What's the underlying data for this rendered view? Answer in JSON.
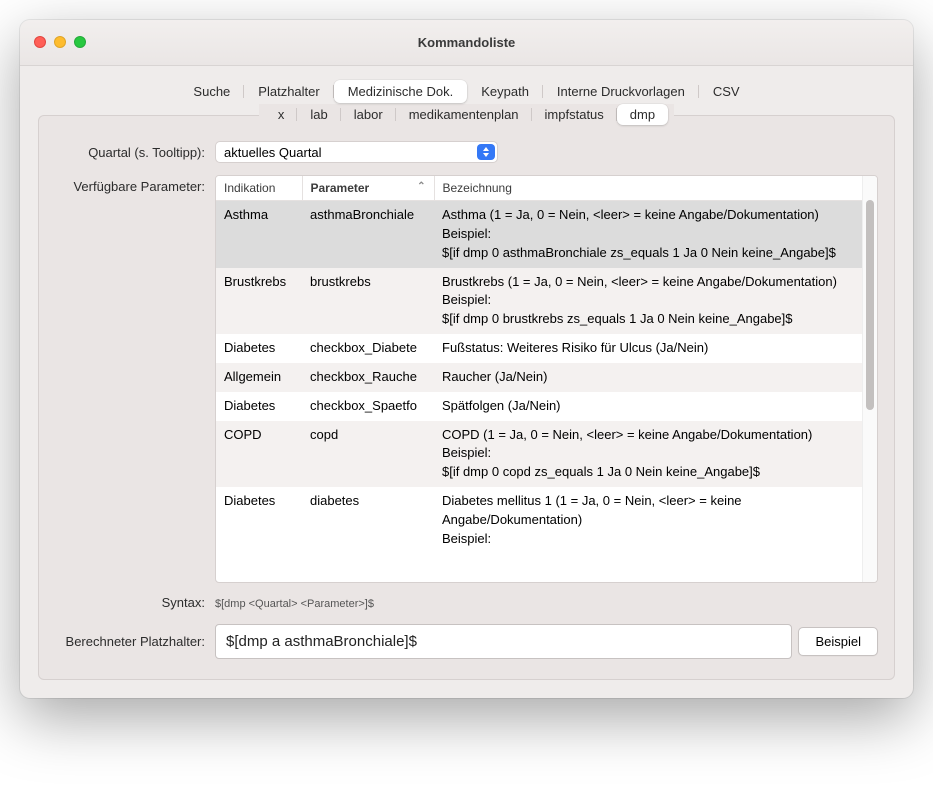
{
  "window": {
    "title": "Kommandoliste"
  },
  "mainTabs": [
    {
      "label": "Suche",
      "active": false
    },
    {
      "label": "Platzhalter",
      "active": false
    },
    {
      "label": "Medizinische Dok.",
      "active": true
    },
    {
      "label": "Keypath",
      "active": false
    },
    {
      "label": "Interne Druckvorlagen",
      "active": false
    },
    {
      "label": "CSV",
      "active": false
    }
  ],
  "subTabs": [
    {
      "label": "x",
      "active": false
    },
    {
      "label": "lab",
      "active": false
    },
    {
      "label": "labor",
      "active": false
    },
    {
      "label": "medikamentenplan",
      "active": false
    },
    {
      "label": "impfstatus",
      "active": false
    },
    {
      "label": "dmp",
      "active": true
    }
  ],
  "labels": {
    "quartal": "Quartal (s. Tooltipp):",
    "parameter": "Verfügbare Parameter:",
    "syntax": "Syntax:",
    "platzhalter": "Berechneter Platzhalter:"
  },
  "quartal": {
    "value": "aktuelles Quartal"
  },
  "columns": {
    "indikation": "Indikation",
    "parameter": "Parameter",
    "bezeichnung": "Bezeichnung"
  },
  "rows": [
    {
      "ind": "Asthma",
      "par": "asthmaBronchiale",
      "bez": "Asthma (1 = Ja, 0 = Nein, <leer> = keine Angabe/Dokumentation)\nBeispiel:\n$[if dmp 0 asthmaBronchiale zs_equals 1 Ja 0 Nein keine_Angabe]$",
      "selected": true
    },
    {
      "ind": "Brustkrebs",
      "par": "brustkrebs",
      "bez": "Brustkrebs (1 = Ja, 0 = Nein, <leer> = keine Angabe/Dokumentation)\nBeispiel:\n$[if dmp 0 brustkrebs zs_equals 1 Ja 0 Nein keine_Angabe]$"
    },
    {
      "ind": "Diabetes",
      "par": "checkbox_Diabete",
      "bez": "Fußstatus: Weiteres Risiko für Ulcus (Ja/Nein)"
    },
    {
      "ind": "Allgemein",
      "par": "checkbox_Rauche",
      "bez": "Raucher (Ja/Nein)"
    },
    {
      "ind": "Diabetes",
      "par": "checkbox_Spaetfo",
      "bez": "Spätfolgen (Ja/Nein)"
    },
    {
      "ind": "COPD",
      "par": "copd",
      "bez": "COPD (1 = Ja, 0 = Nein, <leer> = keine Angabe/Dokumentation)\nBeispiel:\n$[if dmp 0 copd zs_equals 1 Ja 0 Nein keine_Angabe]$"
    },
    {
      "ind": "Diabetes",
      "par": "diabetes",
      "bez": "Diabetes mellitus 1 (1 = Ja, 0 = Nein, <leer> = keine Angabe/Dokumentation)\nBeispiel:"
    }
  ],
  "syntaxText": "$[dmp <Quartal> <Parameter>]$",
  "computedPlaceholder": "$[dmp a asthmaBronchiale]$",
  "beispielBtn": "Beispiel"
}
